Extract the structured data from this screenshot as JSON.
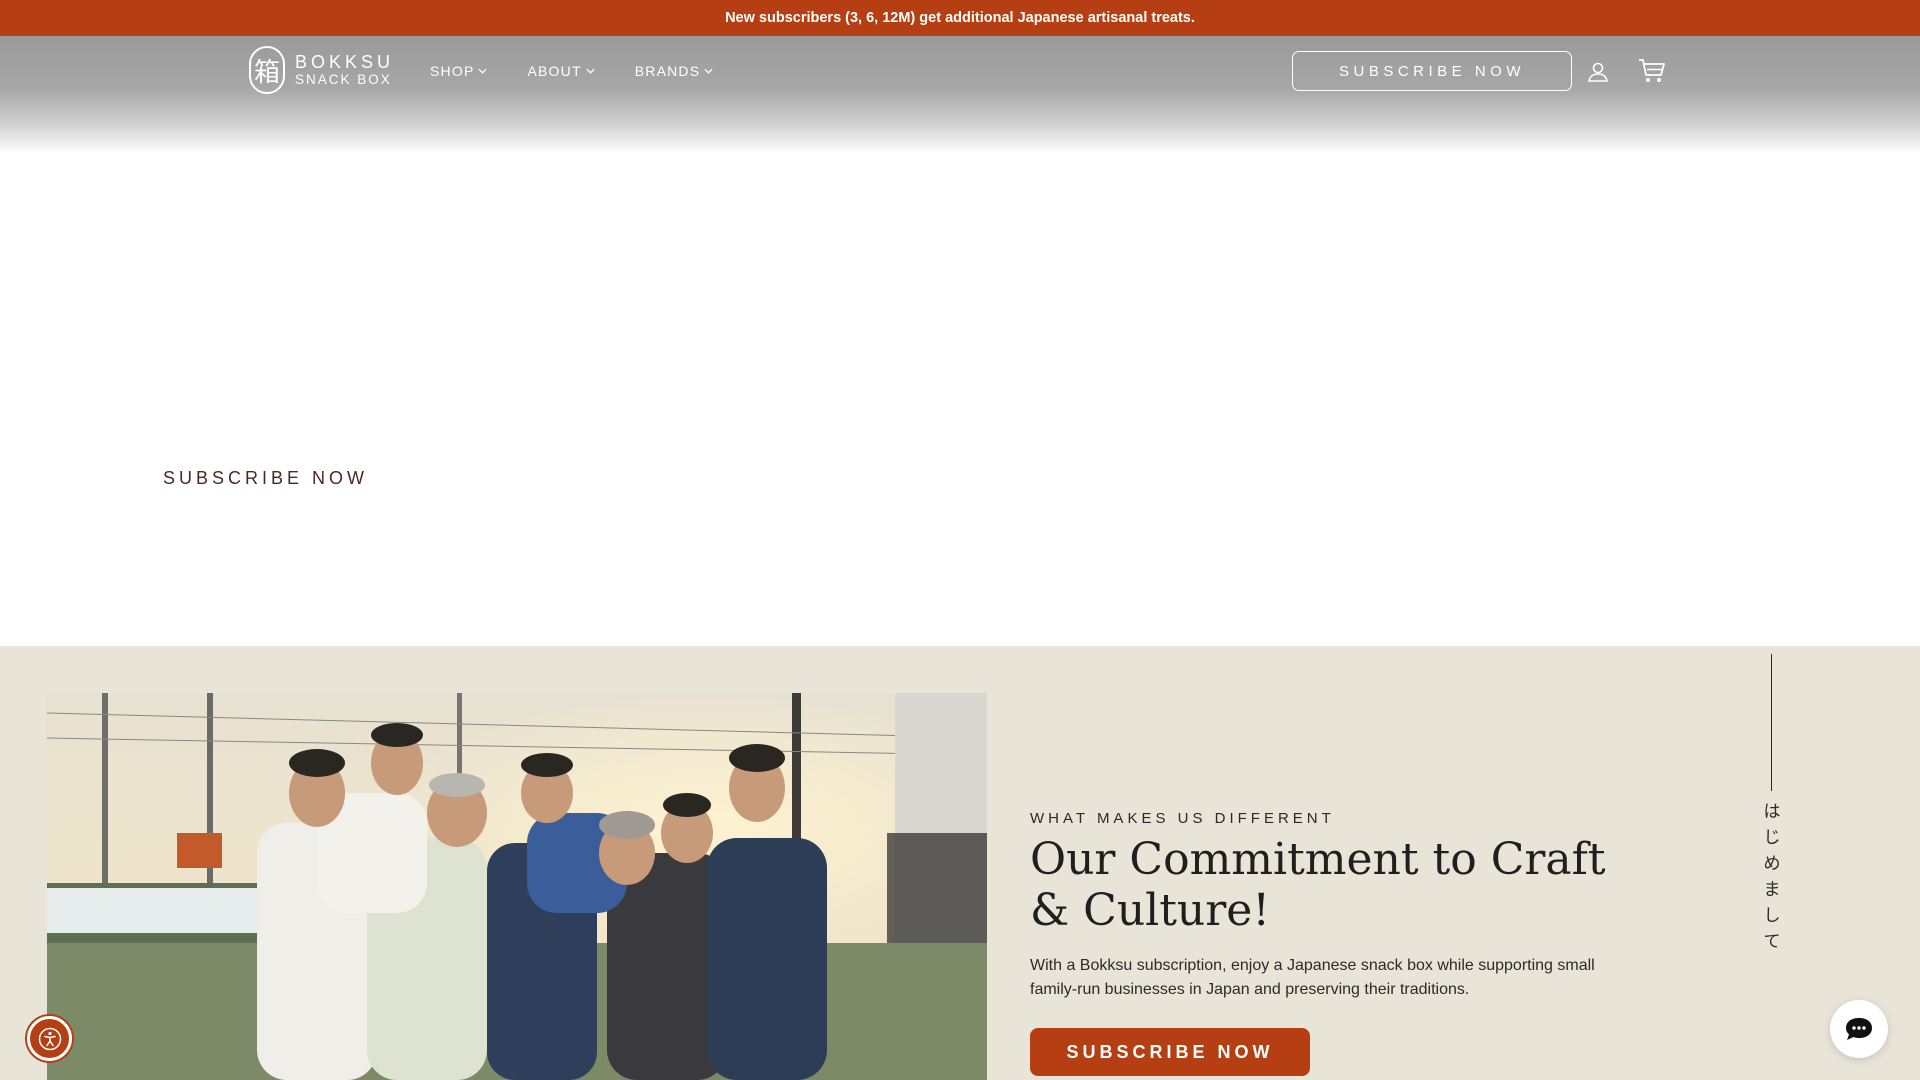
{
  "announcement": {
    "text": "New subscribers (3, 6, 12M) get additional Japanese artisanal treats."
  },
  "header": {
    "logo": {
      "mark": "箱",
      "line1": "BOKKSU",
      "line2": "SNACK BOX"
    },
    "nav": [
      {
        "label": "SHOP",
        "icon": "chevron-down-icon"
      },
      {
        "label": "ABOUT",
        "icon": "chevron-down-icon"
      },
      {
        "label": "BRANDS",
        "icon": "chevron-down-icon"
      }
    ],
    "subscribe_label": "SUBSCRIBE NOW",
    "icons": [
      "account-icon",
      "cart-icon"
    ]
  },
  "hero": {
    "subscribe_label": "SUBSCRIBE NOW"
  },
  "about_section": {
    "eyebrow": "WHAT MAKES US DIFFERENT",
    "heading": "Our Commitment to Craft & Culture!",
    "description": "With a Bokksu subscription, enjoy a Japanese snack box while supporting small family-run businesses in Japan and preserving their traditions.",
    "cta_label": "SUBSCRIBE NOW",
    "vertical_text": "はじめまして"
  },
  "widgets": {
    "accessibility": "accessibility-icon",
    "chat": "chat-icon"
  },
  "colors": {
    "brand": "#b53f12",
    "beige": "#e9e4d8",
    "text_dark": "#1f1f1f"
  }
}
